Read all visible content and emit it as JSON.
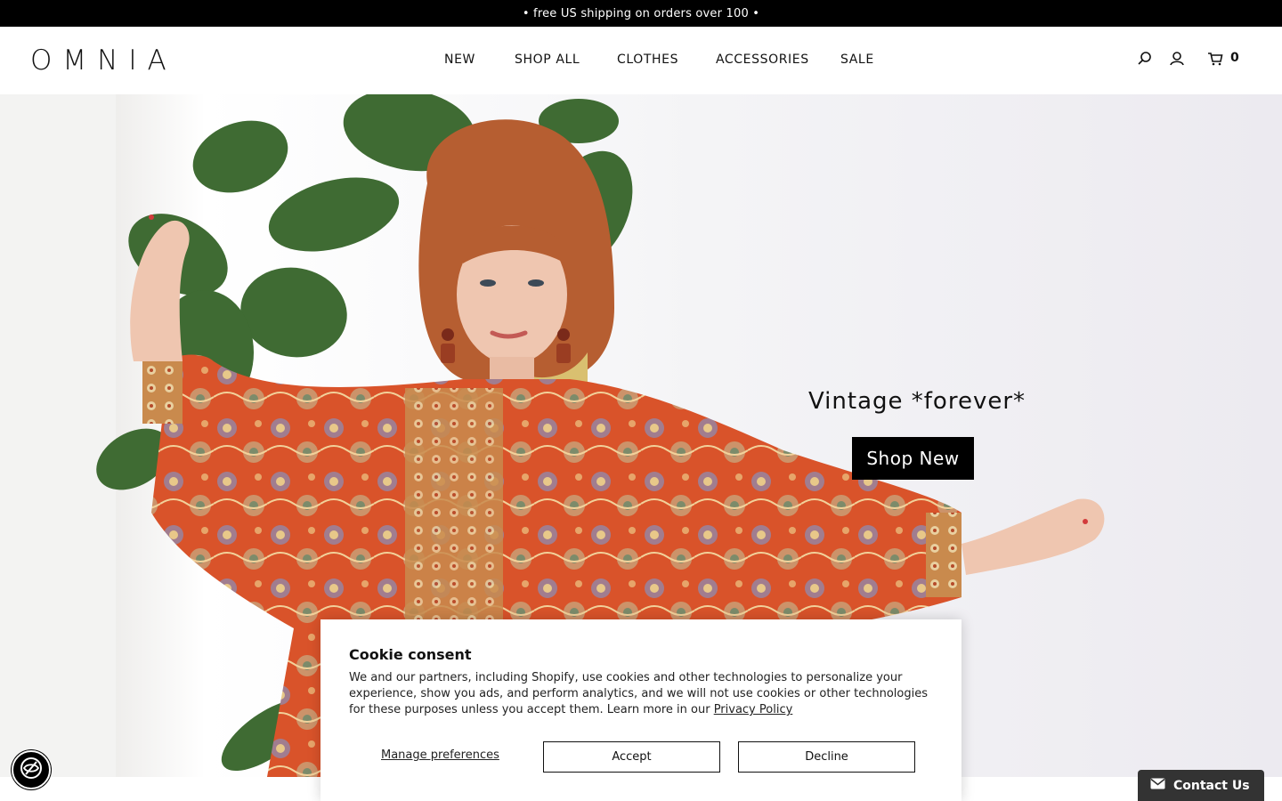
{
  "announcement": "• free US shipping on orders over 100 •",
  "header": {
    "logo": "OMNIA",
    "nav": [
      "NEW",
      "SHOP ALL",
      "CLOTHES",
      "ACCESSORIES",
      "SALE"
    ],
    "icons": [
      "search-icon",
      "account-icon",
      "cart-icon"
    ],
    "cart_count": "0"
  },
  "hero": {
    "title": "Vintage *forever*",
    "button": "Shop New"
  },
  "cookie": {
    "title": "Cookie consent",
    "text": "We and our partners, including Shopify, use cookies and other technologies to personalize your experience, show you ads, and perform analytics, and we will not use cookies or other technologies for these purposes unless you accept them. Learn more in our",
    "link": "Privacy Policy",
    "manage": "Manage preferences",
    "accept": "Accept",
    "decline": "Decline"
  },
  "contact": {
    "label": "Contact Us",
    "icon": "envelope-icon"
  },
  "accessibility": {
    "icon": "eye-slash-icon"
  },
  "colors": {
    "bar": "#000000",
    "button": "#000000",
    "contact_tab": "#333333"
  }
}
